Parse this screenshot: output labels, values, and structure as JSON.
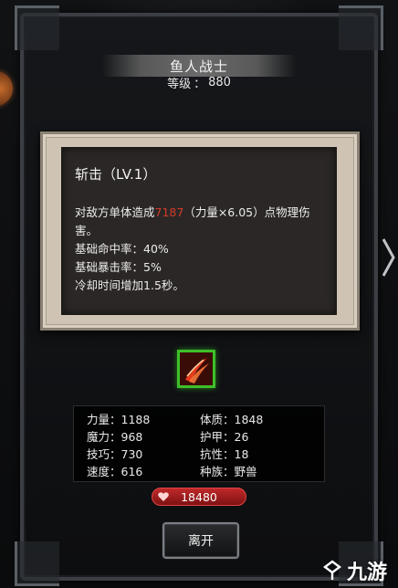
{
  "character": {
    "name": "鱼人战士",
    "level_label": "等级",
    "level_sep": "：",
    "level_value": "880"
  },
  "skill": {
    "name": "斩击（LV.1）",
    "desc_part1": "对敌方单体造成",
    "damage_value": "7187",
    "desc_part2": "（力量×6.05）点物理伤害。",
    "hit_rate": "基础命中率：40%",
    "crit_rate": "基础暴击率：5%",
    "cd_part1": "冷却时间增加",
    "cd_value": "1.5",
    "cd_part2": "秒。"
  },
  "stats": {
    "strength": "力量：1188",
    "constitution": "体质：1848",
    "magic": "魔力：968",
    "armor": "护甲：26",
    "skill": "技巧：730",
    "resistance": "抗性：18",
    "speed": "速度：616",
    "race": "种族：野兽"
  },
  "hp_value": "18480",
  "leave_label": "离开",
  "watermark": "九游",
  "colors": {
    "highlight_red": "#d23c2a",
    "skill_border_green": "#3fbf2a",
    "hp_bar_red": "#c0292a"
  },
  "icons": {
    "skill": "red-slash-icon",
    "hp": "heart-icon",
    "next": "chevron-right-icon"
  }
}
